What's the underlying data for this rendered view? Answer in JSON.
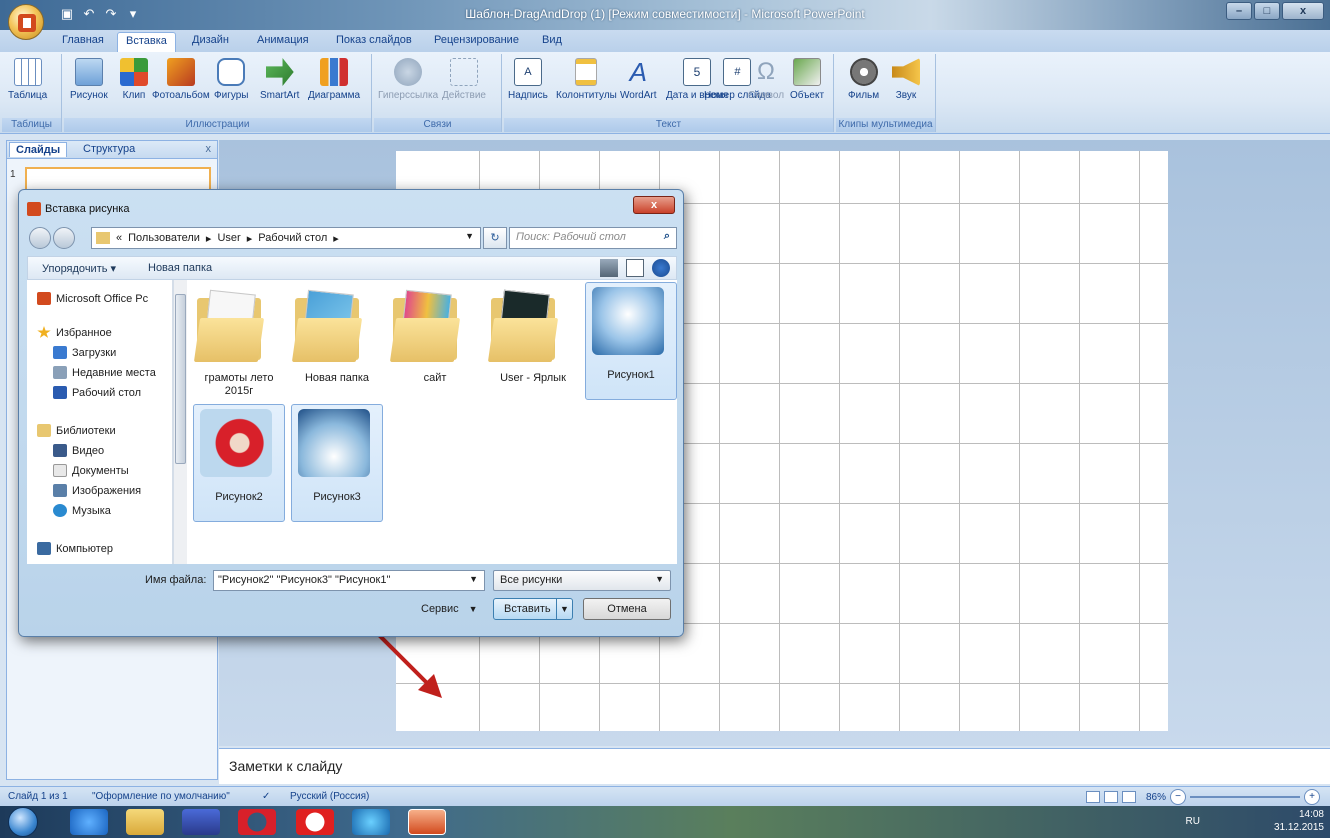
{
  "window": {
    "title": "Шаблон-DragAndDrop (1) [Режим совместимости] - Microsoft PowerPoint",
    "controls": [
      "–",
      "□",
      "x"
    ]
  },
  "ribbon": {
    "tabs": [
      "Главная",
      "Вставка",
      "Дизайн",
      "Анимация",
      "Показ слайдов",
      "Рецензирование",
      "Вид"
    ],
    "active_tab": "Вставка",
    "groups": {
      "tables": {
        "label": "Таблицы",
        "buttons": [
          "Таблица"
        ]
      },
      "illustrations": {
        "label": "Иллюстрации",
        "buttons": [
          "Рисунок",
          "Клип",
          "Фотоальбом",
          "Фигуры",
          "SmartArt",
          "Диаграмма"
        ]
      },
      "links": {
        "label": "Связи",
        "buttons": [
          "Гиперссылка",
          "Действие"
        ]
      },
      "text": {
        "label": "Текст",
        "buttons": [
          "Надпись",
          "Колонтитулы",
          "WordArt",
          "Дата и время",
          "Номер слайда",
          "Символ",
          "Объект"
        ]
      },
      "media": {
        "label": "Клипы мультимедиа",
        "buttons": [
          "Фильм",
          "Звук"
        ]
      }
    }
  },
  "left_panel": {
    "tabs": [
      "Слайды",
      "Структура"
    ],
    "close": "x",
    "slide_number": "1"
  },
  "notes_placeholder": "Заметки к слайду",
  "status": {
    "slide": "Слайд 1 из 1",
    "theme": "\"Оформление по умолчанию\"",
    "language": "Русский (Россия)",
    "zoom": "86%"
  },
  "taskbar": {
    "lang": "RU",
    "time": "14:08",
    "date": "31.12.2015"
  },
  "dialog": {
    "title": "Вставка рисунка",
    "breadcrumb": [
      "«",
      "Пользователи",
      "User",
      "Рабочий стол"
    ],
    "search_placeholder": "Поиск: Рабочий стол",
    "toolbar": {
      "organize": "Упорядочить",
      "new_folder": "Новая папка"
    },
    "nav": {
      "top": "Microsoft Office Pc",
      "favorites": "Избранное",
      "favorites_items": [
        "Загрузки",
        "Недавние места",
        "Рабочий стол"
      ],
      "libraries": "Библиотеки",
      "libraries_items": [
        "Видео",
        "Документы",
        "Изображения",
        "Музыка"
      ],
      "computer": "Компьютер"
    },
    "files": [
      {
        "name": "грамоты лето 2015г",
        "type": "folder"
      },
      {
        "name": "Новая папка",
        "type": "folder"
      },
      {
        "name": "сайт",
        "type": "folder"
      },
      {
        "name": "User - Ярлык",
        "type": "folder"
      },
      {
        "name": "Рисунок1",
        "type": "image"
      },
      {
        "name": "Рисунок2",
        "type": "image"
      },
      {
        "name": "Рисунок3",
        "type": "image"
      }
    ],
    "filename_label": "Имя файла:",
    "filename_value": "\"Рисунок2\" \"Рисунок3\" \"Рисунок1\"",
    "filter": "Все рисунки",
    "service": "Сервис",
    "insert": "Вставить",
    "cancel": "Отмена"
  },
  "colors": {
    "accent": "#15428b",
    "selection": "#cfe4f8",
    "arrow": "#c0201c"
  }
}
